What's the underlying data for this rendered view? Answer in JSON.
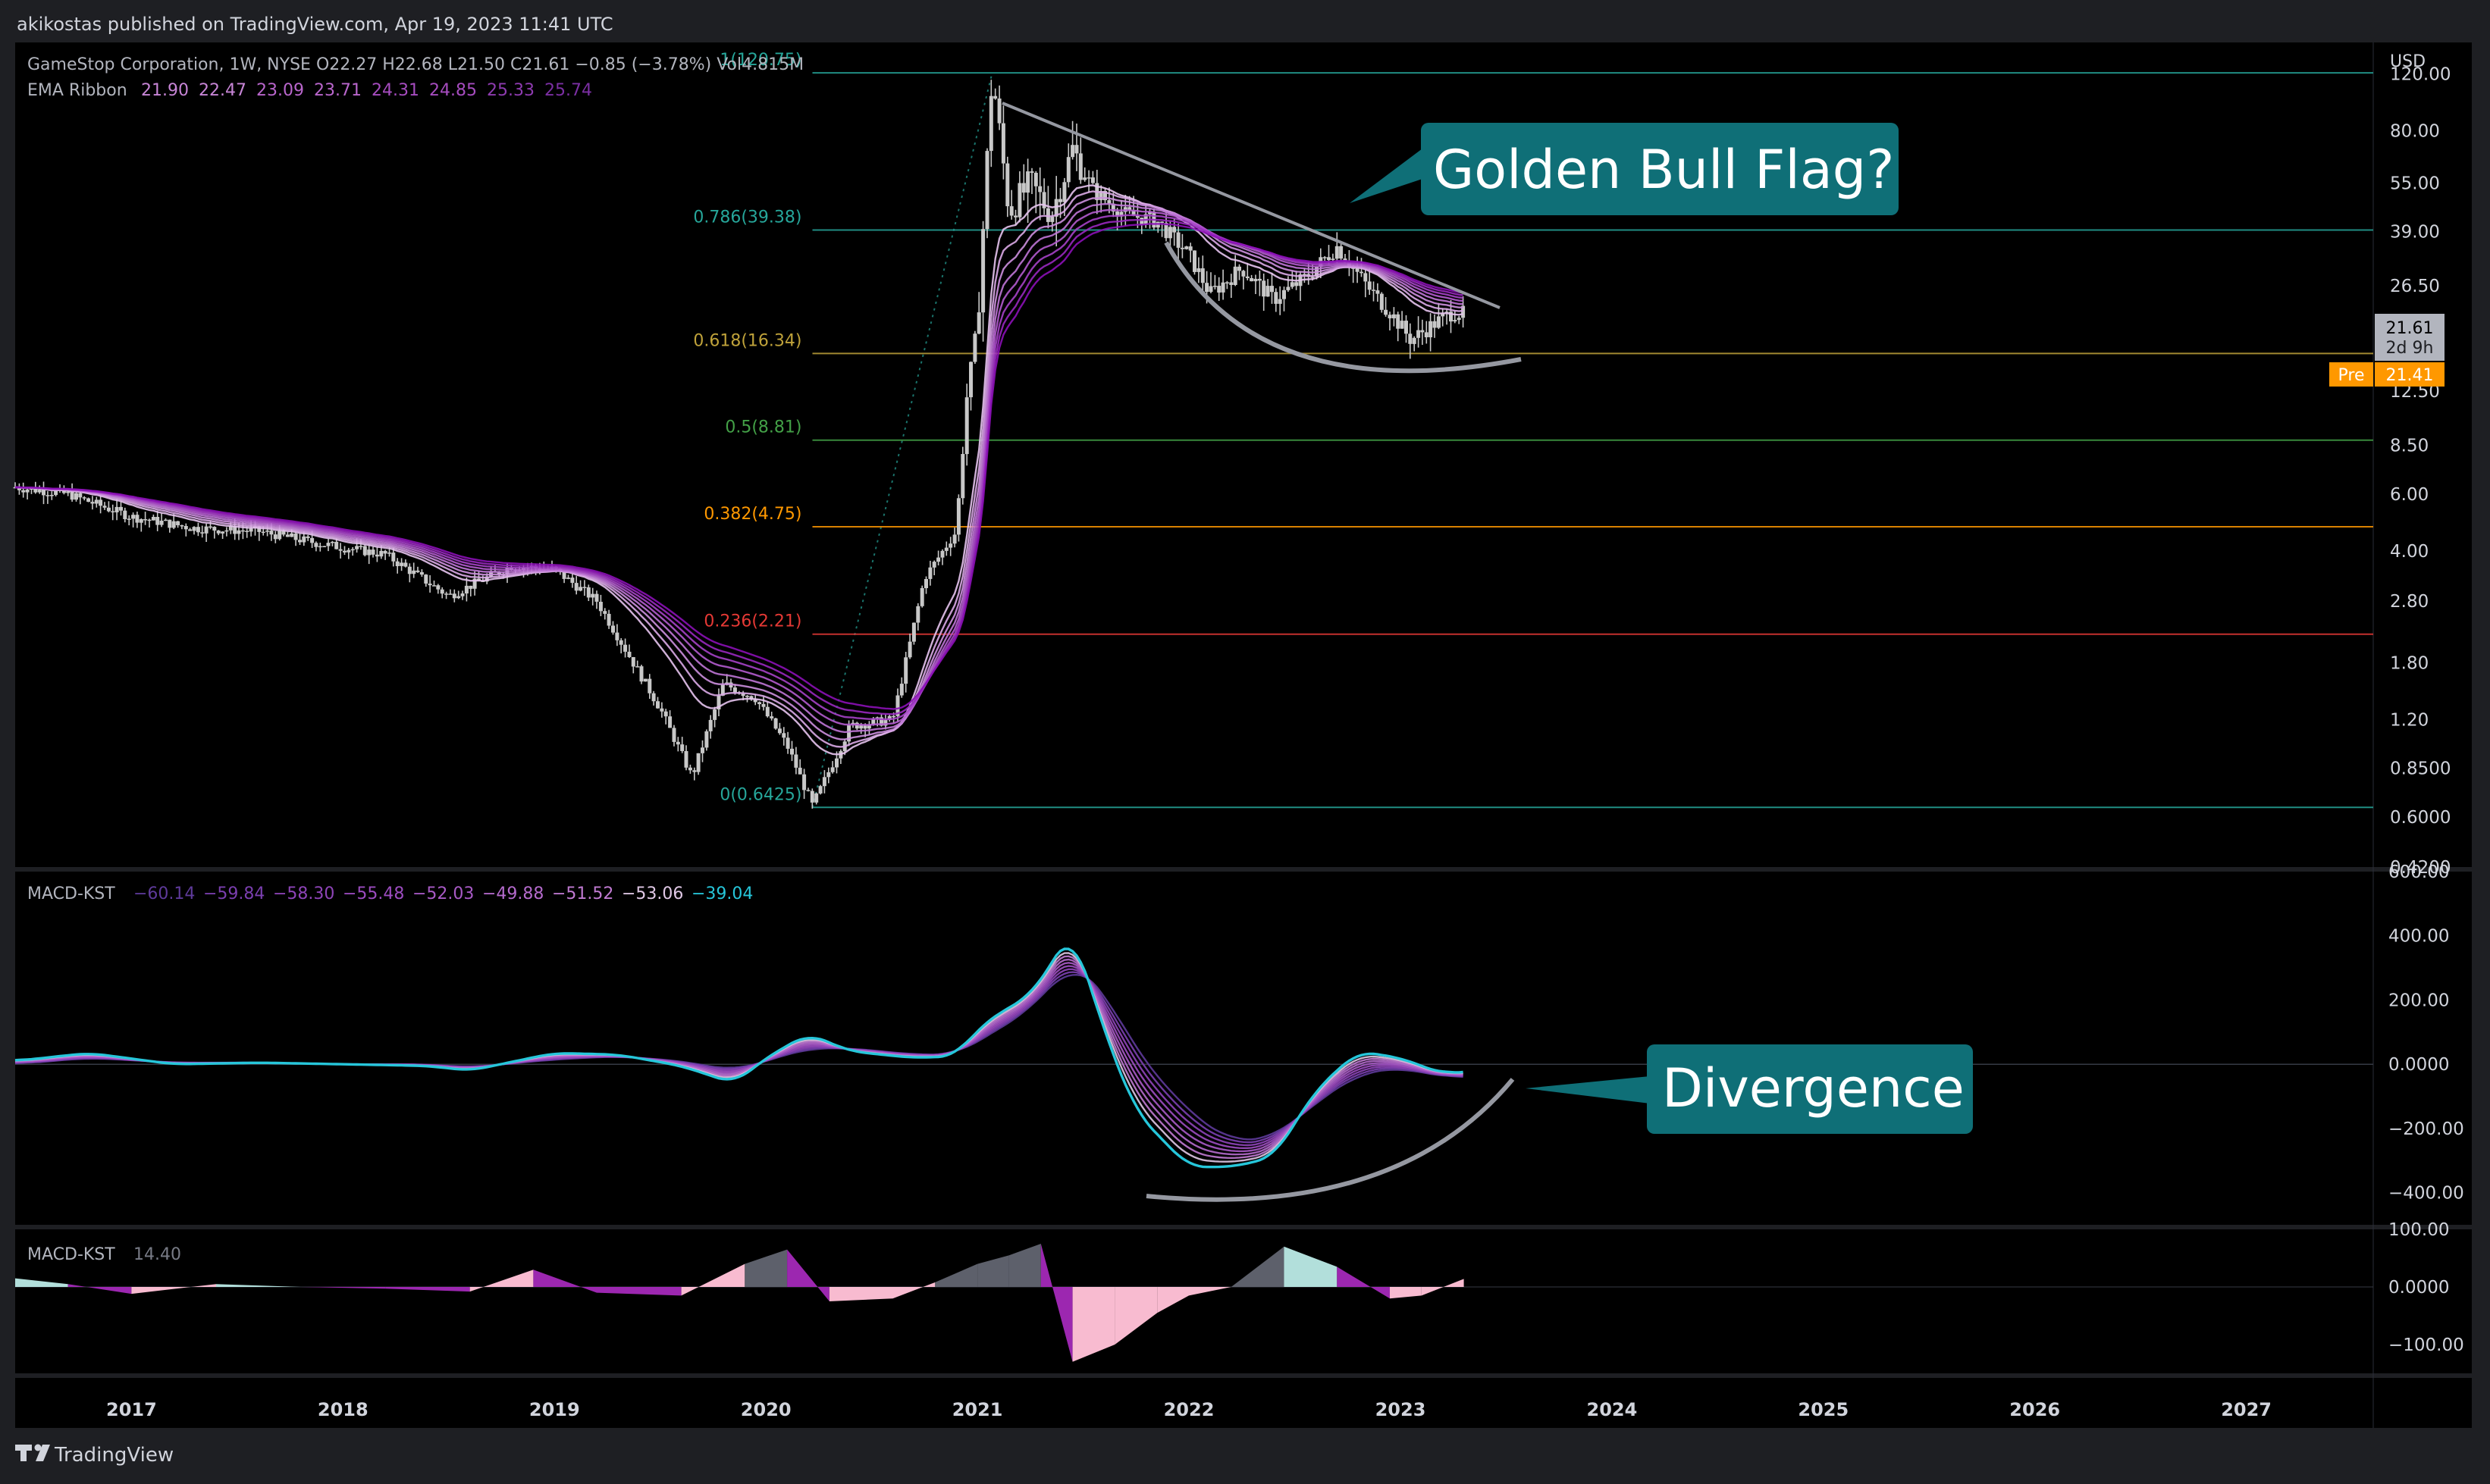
{
  "header": {
    "published": "akikostas published on TradingView.com, Apr 19, 2023 11:41 UTC",
    "footer_brand": "TradingView",
    "footer_logo": "tradingview-logo"
  },
  "colors": {
    "background": "#000000",
    "frame": "#1e1f23",
    "text": "#d1d4dc",
    "muted": "#787b86",
    "candle": "#c8c8c8",
    "ribbon": "#9c27b0",
    "macd_fast": "#26c6da",
    "fib_1": "#26a69a",
    "fib_0786": "#26a69a",
    "fib_0618": "#bfa23a",
    "fib_05": "#43a047",
    "fib_0382": "#ff9800",
    "fib_0236": "#e53935",
    "fib_0": "#26a69a",
    "callout": "#0f6f77",
    "pre_badge": "#ff9800"
  },
  "price_legend": {
    "symbol_line": "GameStop Corporation, 1W, NYSE  O22.27  H22.68  L21.50  C21.61  −0.85 (−3.78%)  Vol4.815M",
    "ema_label": "EMA Ribbon",
    "ema_values": [
      "21.90",
      "22.47",
      "23.09",
      "23.71",
      "24.31",
      "24.85",
      "25.33",
      "25.74"
    ]
  },
  "macd_legend": {
    "label": "MACD-KST",
    "values": [
      "−60.14",
      "−59.84",
      "−58.30",
      "−55.48",
      "−52.03",
      "−49.88",
      "−51.52",
      "−53.06",
      "−39.04"
    ]
  },
  "hist_legend": {
    "label": "MACD-KST",
    "value": "14.40"
  },
  "price_axis": {
    "currency": "USD",
    "ticks": [
      "120.00",
      "80.00",
      "55.00",
      "39.00",
      "26.50",
      "12.50",
      "8.50",
      "6.00",
      "4.00",
      "2.80",
      "1.80",
      "1.20",
      "0.8500",
      "0.6000",
      "0.4200"
    ],
    "last_price": "21.61",
    "countdown": "2d 9h",
    "pre_label": "Pre",
    "pre_price": "21.41"
  },
  "macd_axis": {
    "ticks": [
      "600.00",
      "400.00",
      "200.00",
      "0.0000",
      "−200.00",
      "−400.00"
    ]
  },
  "hist_axis": {
    "ticks": [
      "100.00",
      "0.0000",
      "−100.00"
    ]
  },
  "time_axis": {
    "ticks": [
      "2017",
      "2018",
      "2019",
      "2020",
      "2021",
      "2022",
      "2023",
      "2024",
      "2025",
      "2026",
      "2027"
    ]
  },
  "fib_levels": [
    {
      "label": "1(120.75)",
      "price": 120.75,
      "color": "#26a69a"
    },
    {
      "label": "0.786(39.38)",
      "price": 39.38,
      "color": "#26a69a"
    },
    {
      "label": "0.618(16.34)",
      "price": 16.34,
      "color": "#bfa23a"
    },
    {
      "label": "0.5(8.81)",
      "price": 8.81,
      "color": "#43a047"
    },
    {
      "label": "0.382(4.75)",
      "price": 4.75,
      "color": "#ff9800"
    },
    {
      "label": "0.236(2.21)",
      "price": 2.21,
      "color": "#e53935"
    },
    {
      "label": "0(0.6425)",
      "price": 0.6425,
      "color": "#26a69a"
    }
  ],
  "annotations": {
    "callout_1": "Golden Bull Flag?",
    "callout_2": "Divergence"
  },
  "chart_data": {
    "type": "line",
    "y_scale": "log",
    "x_range": [
      2016.45,
      2027.6
    ],
    "price_ylim": [
      0.42,
      150
    ],
    "macd_ylim": [
      -500,
      600
    ],
    "hist_ylim": [
      -150,
      100
    ],
    "price": {
      "x": [
        2016.45,
        2016.7,
        2017.0,
        2017.3,
        2017.6,
        2017.9,
        2018.2,
        2018.5,
        2018.8,
        2019.0,
        2019.2,
        2019.5,
        2019.65,
        2019.8,
        2019.95,
        2020.1,
        2020.22,
        2020.4,
        2020.6,
        2020.75,
        2020.9,
        2020.95,
        2021.0,
        2021.07,
        2021.15,
        2021.25,
        2021.35,
        2021.45,
        2021.55,
        2021.7,
        2021.85,
        2022.0,
        2022.1,
        2022.25,
        2022.4,
        2022.55,
        2022.7,
        2022.85,
        2022.95,
        2023.05,
        2023.15,
        2023.25,
        2023.3
      ],
      "y": [
        6.3,
        6.0,
        5.1,
        4.7,
        4.6,
        4.2,
        3.9,
        2.9,
        3.6,
        3.5,
        2.8,
        1.3,
        0.8,
        1.55,
        1.4,
        1.0,
        0.65,
        1.15,
        1.2,
        3.3,
        4.6,
        12.0,
        20.0,
        120.75,
        45.0,
        55.0,
        44.0,
        70.0,
        52.0,
        44.0,
        42.0,
        33.0,
        25.0,
        30.0,
        24.0,
        28.0,
        35.0,
        26.0,
        22.0,
        18.0,
        20.0,
        22.0,
        21.61
      ]
    },
    "macd": {
      "x": [
        2016.45,
        2016.8,
        2017.2,
        2017.6,
        2018.0,
        2018.4,
        2018.6,
        2019.0,
        2019.3,
        2019.6,
        2019.85,
        2020.0,
        2020.2,
        2020.4,
        2020.7,
        2020.9,
        2021.0,
        2021.15,
        2021.25,
        2021.45,
        2021.6,
        2021.75,
        2022.0,
        2022.2,
        2022.4,
        2022.6,
        2022.8,
        2023.0,
        2023.2,
        2023.3
      ],
      "fast": [
        10,
        35,
        0,
        5,
        0,
        -5,
        -20,
        35,
        30,
        -5,
        -60,
        20,
        95,
        40,
        20,
        25,
        110,
        180,
        210,
        420,
        100,
        -150,
        -320,
        -320,
        -290,
        -80,
        40,
        20,
        -30,
        -20
      ],
      "slow": [
        0,
        20,
        5,
        5,
        0,
        0,
        -10,
        15,
        25,
        10,
        -20,
        10,
        50,
        50,
        30,
        30,
        70,
        130,
        170,
        320,
        230,
        40,
        -150,
        -240,
        -230,
        -120,
        -30,
        -10,
        -40,
        -39
      ]
    },
    "hist": {
      "x": [
        2016.45,
        2016.7,
        2017.0,
        2017.4,
        2017.8,
        2018.2,
        2018.6,
        2018.9,
        2019.2,
        2019.6,
        2019.9,
        2020.1,
        2020.3,
        2020.6,
        2020.8,
        2021.0,
        2021.15,
        2021.3,
        2021.45,
        2021.65,
        2021.85,
        2022.0,
        2022.2,
        2022.45,
        2022.7,
        2022.95,
        2023.1,
        2023.3
      ],
      "values": [
        15,
        5,
        -12,
        5,
        0,
        -3,
        -8,
        30,
        -10,
        -15,
        40,
        65,
        -25,
        -20,
        8,
        40,
        55,
        75,
        -130,
        -100,
        -45,
        -15,
        0,
        70,
        35,
        -20,
        -15,
        14
      ]
    }
  }
}
